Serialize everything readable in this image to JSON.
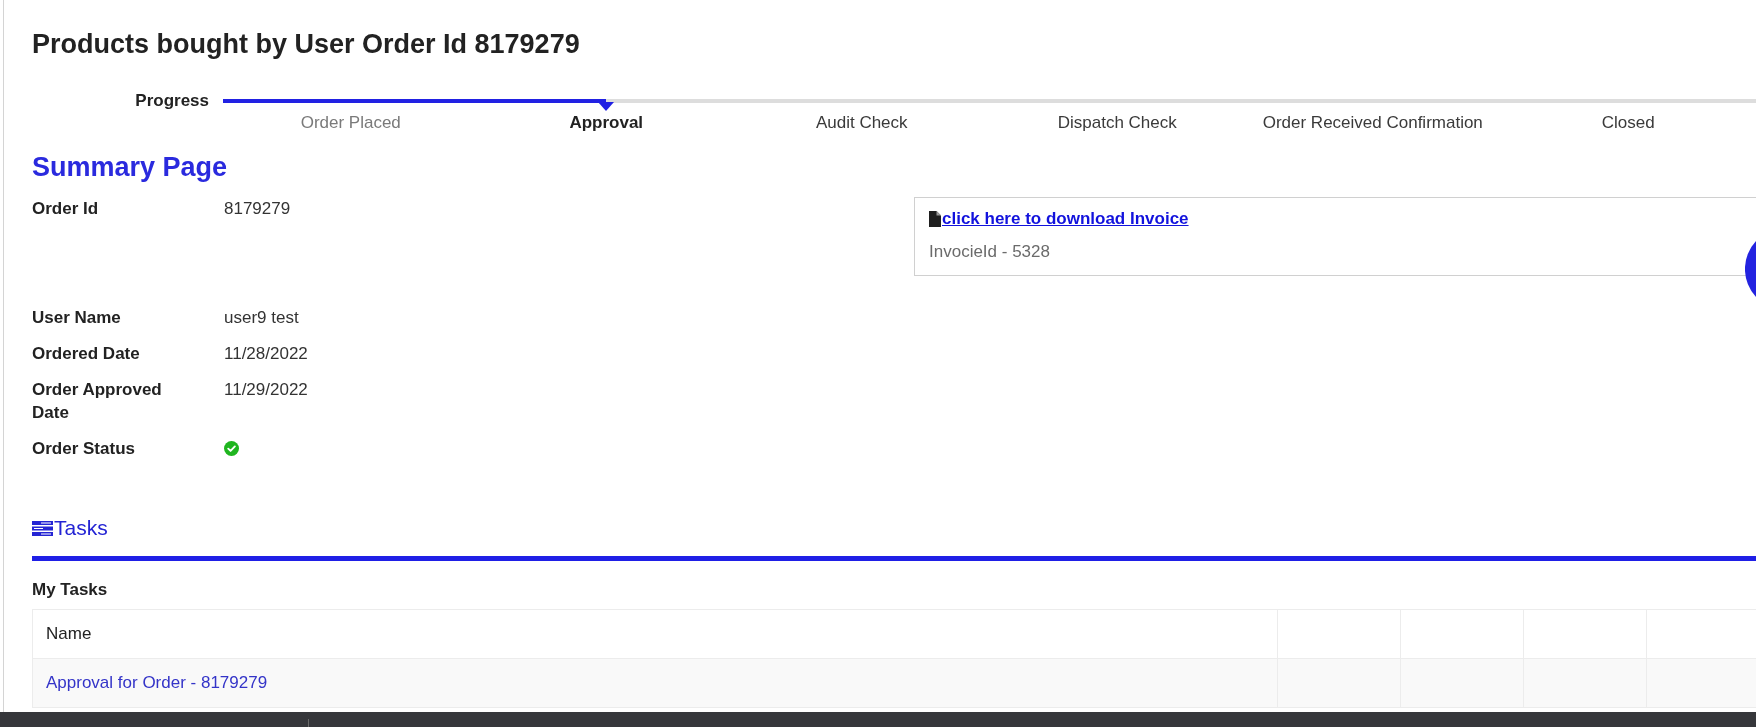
{
  "title": "Products bought by User Order Id 8179279",
  "progress": {
    "label": "Progress",
    "steps": [
      {
        "label": "Order Placed",
        "completed": true,
        "selected": false
      },
      {
        "label": "Approval",
        "completed": false,
        "selected": true
      },
      {
        "label": "Audit Check",
        "completed": false,
        "selected": false
      },
      {
        "label": "Dispatch Check",
        "completed": false,
        "selected": false
      },
      {
        "label": "Order Received Confirmation",
        "completed": false,
        "selected": false
      },
      {
        "label": "Closed",
        "completed": false,
        "selected": false
      }
    ]
  },
  "summary": {
    "title": "Summary Page",
    "fields": [
      {
        "kind": "text",
        "label": "Order Id",
        "value": "8179279"
      },
      {
        "kind": "text",
        "label": "User Name",
        "value": "user9 test"
      },
      {
        "kind": "text",
        "label": "Ordered Date",
        "value": "11/28/2022"
      },
      {
        "kind": "text",
        "label": "Order Approved Date",
        "value": "11/29/2022"
      },
      {
        "kind": "status",
        "label": "Order Status",
        "approved": true
      }
    ]
  },
  "invoice": {
    "link": "click here to download Invoice",
    "note": "InvocieId - 5328"
  },
  "tasks": {
    "title": "Tasks",
    "subtitle": "My Tasks",
    "columns": [
      "Name"
    ],
    "rows": [
      {
        "name": "Approval for Order - 8179279"
      }
    ]
  }
}
